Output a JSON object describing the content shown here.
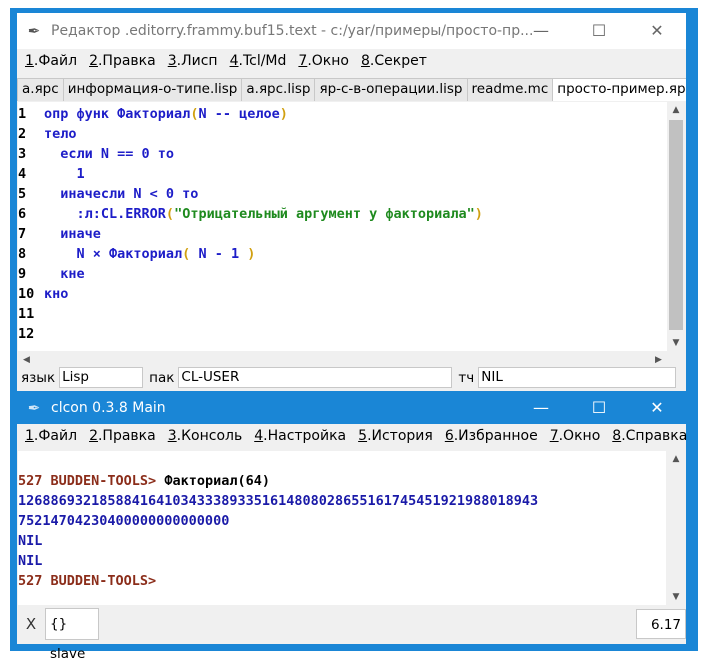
{
  "editor": {
    "title": "Редактор .editorry.frammy.buf15.text - c:/yar/примеры/просто-пр...",
    "buttons": {
      "minimize": "—",
      "maximize": "☐",
      "close": "✕"
    },
    "menu": [
      {
        "num": "1",
        "label": ".Файл"
      },
      {
        "num": "2",
        "label": ".Правка"
      },
      {
        "num": "3",
        "label": ".Лисп"
      },
      {
        "num": "4",
        "label": ".Tcl/Md"
      },
      {
        "num": "7",
        "label": ".Окно"
      },
      {
        "num": "8",
        "label": ".Секрет"
      }
    ],
    "tabs": [
      "а.ярс",
      "информация-о-типе.lisp",
      "а.ярс.lisp",
      "яр-с-в-операции.lisp",
      "readme.mc",
      "просто-пример.ярс"
    ],
    "active_tab": 5,
    "lines": [
      {
        "n": "1",
        "t": "опр функ Факториал(N -- целое)"
      },
      {
        "n": "2",
        "t": "тело"
      },
      {
        "n": "3",
        "t": "  если N == 0 то"
      },
      {
        "n": "4",
        "t": "    1"
      },
      {
        "n": "5",
        "t": "  иначесли N < 0 то"
      },
      {
        "n": "6",
        "t": "    :л:CL.ERROR(\"Отрицательный аргумент у факториала\")"
      },
      {
        "n": "7",
        "t": "  иначе"
      },
      {
        "n": "8",
        "t": "    N × Факториал( N - 1 )"
      },
      {
        "n": "9",
        "t": "  кне"
      },
      {
        "n": "10",
        "t": "кно"
      },
      {
        "n": "11",
        "t": ""
      },
      {
        "n": "12",
        "t": ""
      }
    ],
    "status": {
      "lang_label": "язык",
      "lang_value": "Lisp",
      "pkg_label": "пак",
      "pkg_value": "CL-USER",
      "rt_label": "тч",
      "rt_value": "NIL"
    }
  },
  "console": {
    "title": "clcon 0.3.8 Main",
    "menu": [
      {
        "num": "1",
        "label": ".Файл"
      },
      {
        "num": "2",
        "label": ".Правка"
      },
      {
        "num": "3",
        "label": ".Консоль"
      },
      {
        "num": "4",
        "label": ".Настройка"
      },
      {
        "num": "5",
        "label": ".История"
      },
      {
        "num": "6",
        "label": ".Избранное"
      },
      {
        "num": "7",
        "label": ".Окно"
      },
      {
        "num": "8",
        "label": ".Справка"
      }
    ],
    "output": [
      {
        "kind": "prompt",
        "prompt": "527 BUDDEN-TOOLS> ",
        "input": "Факториал(64)"
      },
      {
        "kind": "result",
        "text": "126886932185884164103433389335161480802865516174545192198801894З"
      },
      {
        "kind": "result",
        "text": "75214704230400000000000000"
      },
      {
        "kind": "result",
        "text": "NIL"
      },
      {
        "kind": "result",
        "text": "NIL"
      },
      {
        "kind": "prompt",
        "prompt": "527 BUDDEN-TOOLS>",
        "input": ""
      }
    ],
    "bottom": {
      "close": "X",
      "slave": "{} slave",
      "version": "6.17"
    }
  }
}
